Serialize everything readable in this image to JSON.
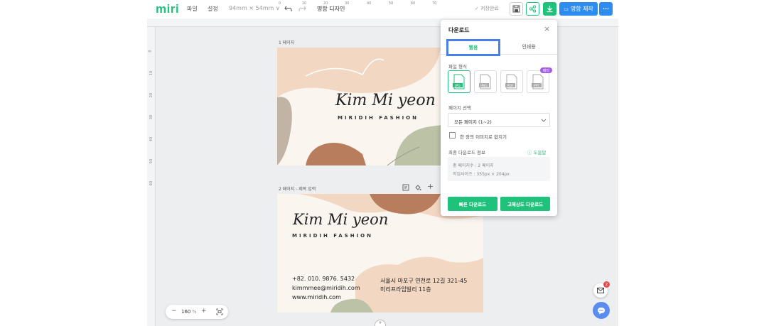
{
  "app": {
    "logo": "miri"
  },
  "menu": {
    "file": "파일",
    "settings": "설정",
    "size": "94mm × 54mm ∨",
    "title": "명함 디자인"
  },
  "toolbar": {
    "saved": "✓ 저장완료",
    "print_label": "명함 제작",
    "more": "···"
  },
  "ruler": {
    "top": [
      "0",
      "10",
      "20",
      "30",
      "40",
      "50",
      "60",
      "70"
    ],
    "left": [
      "0",
      "10",
      "20",
      "30",
      "40",
      "50",
      "60"
    ]
  },
  "pages": [
    {
      "label": "1 페이지",
      "name": "Kim Mi yeon",
      "brand": "MIRIDIH FASHION"
    },
    {
      "label": "2 페이지 - 제목 입력",
      "name": "Kim Mi yeon",
      "brand": "MIRIDIH FASHION",
      "phone": "+82. 010. 9876. 5432",
      "email": "kimmmee@miridih.com",
      "web": "www.miridih.com",
      "address1": "서울시 마포구 연천로 12길 321-45",
      "address2": "미리프라임빌리 11층"
    }
  ],
  "download_panel": {
    "title": "다운로드",
    "tabs": [
      "웹용",
      "인쇄용"
    ],
    "format_label": "파일 형식",
    "formats": [
      "JPG",
      "PNG",
      "PDF",
      "PPT"
    ],
    "ppt_badge": "베타",
    "page_select_label": "페이지 선택",
    "page_select_value": "모든 페이지 (1~2)",
    "merge_label": "한 장의 이미지로 합치기",
    "info_label": "최종 다운로드 정보",
    "help_label": "ⓘ 도움말",
    "info_pages": "총 페이지수 : 2 페이지",
    "info_size": "작업사이즈 : 355px × 204px",
    "quick_button": "빠른 다운로드",
    "hq_button": "고해상도 다운로드"
  },
  "zoom": {
    "minus": "−",
    "value": "160",
    "unit": "%",
    "plus": "+"
  },
  "notification_count": "2",
  "colors": {
    "brand_green": "#1fc27b",
    "accent_blue": "#2d8cf0",
    "card_bg": "#fbf5ef",
    "peach": "#f2d7c2",
    "terracotta": "#b87d5c",
    "sage": "#bcc2a6",
    "taupe": "#c1b4a6"
  }
}
